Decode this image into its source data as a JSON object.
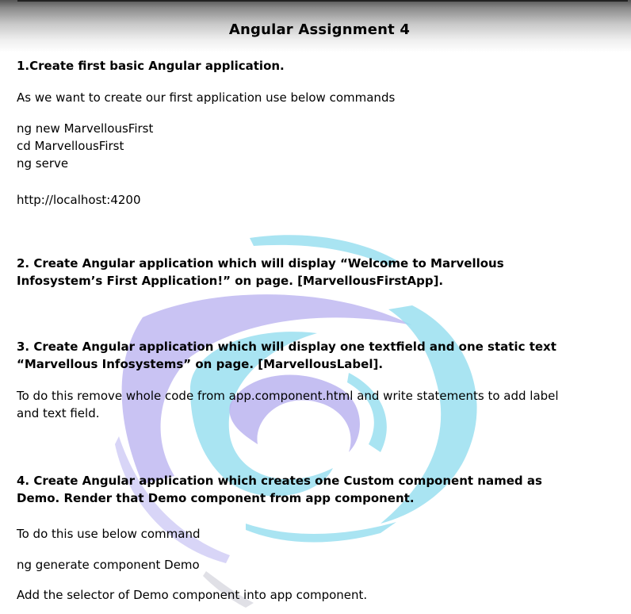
{
  "document": {
    "title": "Angular Assignment 4",
    "q1": {
      "heading": "1.Create first basic Angular application.",
      "intro": "As we want to create our first application use below commands",
      "commands": [
        "ng new MarvellousFirst",
        "cd MarvellousFirst",
        "ng serve"
      ],
      "url": "http://localhost:4200"
    },
    "q2": {
      "heading_line1": "2. Create Angular application which will display “Welcome to Marvellous",
      "heading_line2": "Infosystem’s First Application!” on page. [MarvellousFirstApp]."
    },
    "q3": {
      "heading_line1": "3. Create Angular application which will display one textfield and one static text",
      "heading_line2": "“Marvellous Infosystems” on page. [MarvellousLabel].",
      "body_line1": "To do this remove whole code from app.component.html and write statements to add label",
      "body_line2": "and text field."
    },
    "q4": {
      "heading_line1": "4. Create Angular application which creates one Custom component named as",
      "heading_line2": "Demo. Render that Demo component from app component.",
      "body1": "To do this use below command",
      "command": "ng generate component Demo",
      "body2": "Add the selector of Demo component into app component."
    }
  },
  "colors": {
    "watermark_cyan": "#8fdcef",
    "watermark_violet": "#b8b0f0",
    "header_dark": "#555555"
  }
}
